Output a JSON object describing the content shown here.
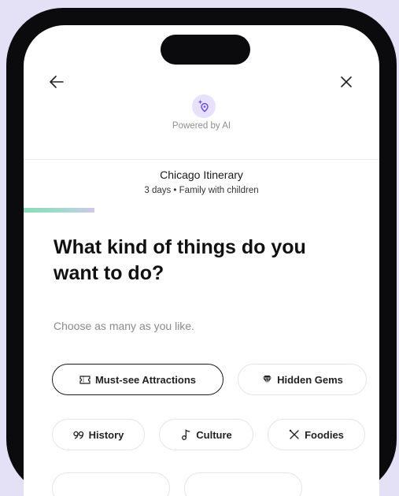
{
  "header": {
    "powered_label": "Powered by AI"
  },
  "trip": {
    "title": "Chicago Itinerary",
    "meta": "3 days • Family with children"
  },
  "progress": {
    "fraction": 0.2
  },
  "question": {
    "title": "What kind of things do you want to do?",
    "subtitle": "Choose as many as you like."
  },
  "chips": [
    {
      "label": "Must-see Attractions",
      "icon": "ticket-icon",
      "selected": true
    },
    {
      "label": "Hidden Gems",
      "icon": "gem-icon",
      "selected": false
    },
    {
      "label": "History",
      "icon": "quote-icon",
      "selected": false
    },
    {
      "label": "Culture",
      "icon": "music-note-icon",
      "selected": false
    },
    {
      "label": "Foodies",
      "icon": "utensils-icon",
      "selected": false
    }
  ],
  "colors": {
    "page_bg": "#e4e1f6",
    "ai_badge_bg": "#e7e1fb",
    "ai_badge_icon": "#6c4fd8",
    "progress_start": "#8bdcb8",
    "progress_end": "#cfc9ea"
  }
}
